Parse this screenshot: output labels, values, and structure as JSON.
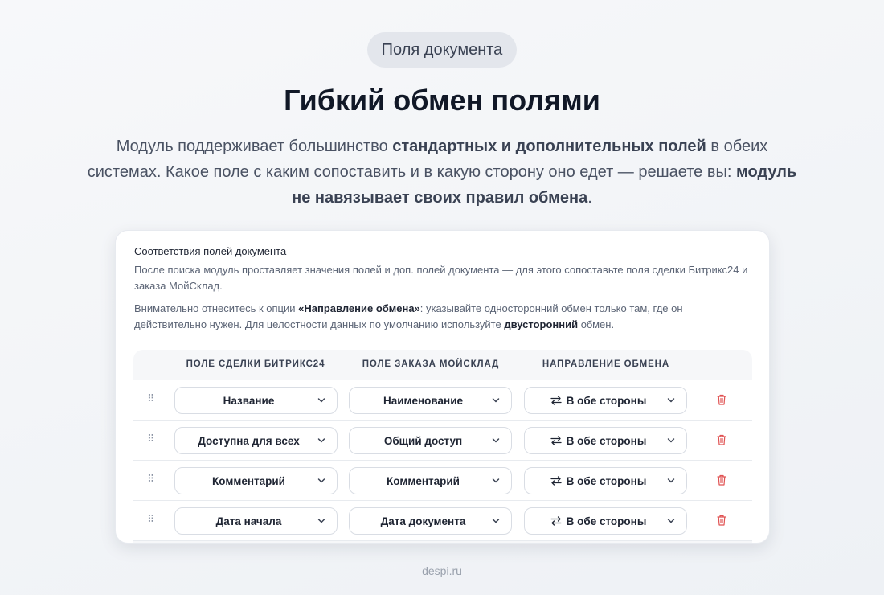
{
  "badge": "Поля документа",
  "title": "Гибкий обмен полями",
  "lead": {
    "p1": "Модуль поддерживает большинство ",
    "b1": "стандартных и дополнительных полей",
    "p2": " в обеих системах. Какое поле с каким сопоставить и в какую сторону оно едет — решаете вы: ",
    "b2": "модуль не навязывает своих правил обмена",
    "p3": "."
  },
  "card": {
    "title": "Соответствия полей документа",
    "p1": "После поиска модуль проставляет значения полей и доп. полей документа — для этого сопоставьте поля сделки Битрикс24 и заказа МойСклад.",
    "p2a": "Внимательно отнеситесь к опции ",
    "p2b": "«Направление обмена»",
    "p2c": ": указывайте односторонний обмен только там, где он действительно нужен. Для целостности данных по умолчанию используйте ",
    "p2d": "двусторонний",
    "p2e": " обмен."
  },
  "table": {
    "headers": [
      "ПОЛЕ СДЕЛКИ БИТРИКС24",
      "ПОЛЕ ЗАКАЗА МОЙСКЛАД",
      "НАПРАВЛЕНИЕ ОБМЕНА"
    ],
    "rows": [
      {
        "b24": "Название",
        "ms": "Наименование",
        "dir": "В обе стороны"
      },
      {
        "b24": "Доступна для всех",
        "ms": "Общий доступ",
        "dir": "В обе стороны"
      },
      {
        "b24": "Комментарий",
        "ms": "Комментарий",
        "dir": "В обе стороны"
      },
      {
        "b24": "Дата начала",
        "ms": "Дата документа",
        "dir": "В обе стороны"
      }
    ]
  },
  "icons": {
    "grip": "drag-handle-icon",
    "chevron": "chevron-down-icon",
    "swap": "swap-arrows-icon",
    "trash": "trash-icon"
  },
  "colors": {
    "trash": "#e05252",
    "accent_text": "#1f2533"
  },
  "footer": "despi.ru"
}
